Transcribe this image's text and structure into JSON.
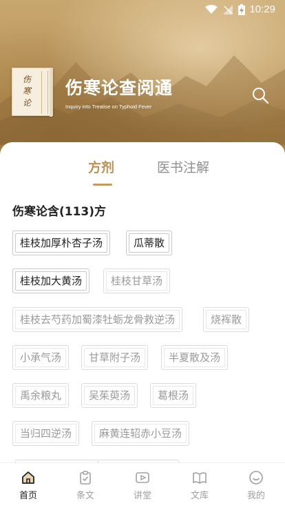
{
  "status_bar": {
    "time": "10:29"
  },
  "header": {
    "logo_text": [
      "伤",
      "寒",
      "论"
    ],
    "title": "伤寒论查阅通",
    "subtitle": "Inquiry into Treatise on Typhoid Fever"
  },
  "tabs": [
    {
      "label": "方剂",
      "active": true
    },
    {
      "label": "医书注解",
      "active": false
    }
  ],
  "section_title": "伤寒论含(113)方",
  "prescriptions": [
    "桂枝加厚朴杏子汤",
    "瓜蒂散",
    "桂枝加大黄汤",
    "桂枝甘草汤",
    "桂枝去芍药加蜀漆牡蛎龙骨救逆汤",
    "烧裈散",
    "小承气汤",
    "甘草附子汤",
    "半夏散及汤",
    "禹余粮丸",
    "吴茱萸汤",
    "葛根汤",
    "当归四逆汤",
    "麻黄连轺赤小豆汤"
  ],
  "bottom_nav": [
    {
      "label": "首页",
      "icon": "home-icon",
      "active": true
    },
    {
      "label": "条文",
      "icon": "clipboard-check-icon",
      "active": false
    },
    {
      "label": "讲堂",
      "icon": "play-icon",
      "active": false
    },
    {
      "label": "文库",
      "icon": "book-icon",
      "active": false
    },
    {
      "label": "我的",
      "icon": "smile-icon",
      "active": false
    }
  ],
  "colors": {
    "accent": "#bb9155",
    "hero": "#c8a76f"
  }
}
